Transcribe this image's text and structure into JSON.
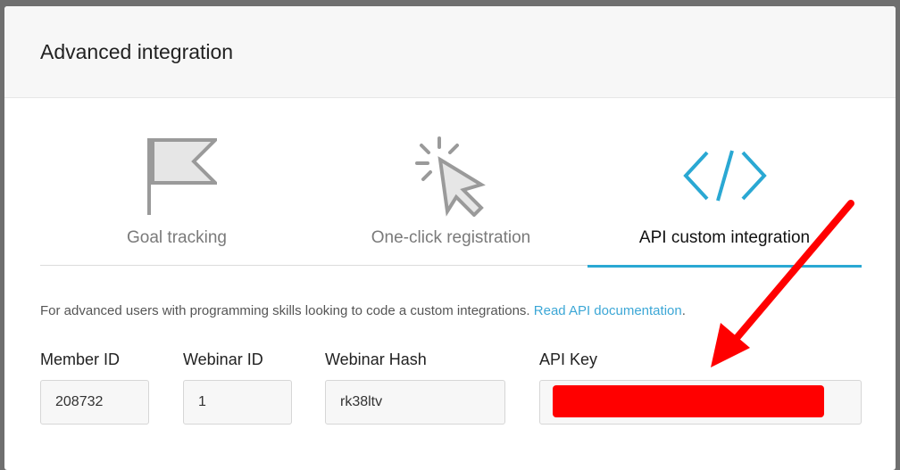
{
  "modal": {
    "title": "Advanced integration"
  },
  "tabs": [
    {
      "label": "Goal tracking",
      "icon": "flag-icon",
      "active": false
    },
    {
      "label": "One-click registration",
      "icon": "cursor-click-icon",
      "active": false
    },
    {
      "label": "API custom integration",
      "icon": "code-icon",
      "active": true
    }
  ],
  "description": {
    "text": "For advanced users with programming skills looking to code a custom integrations. ",
    "link_text": "Read API documentation",
    "suffix": "."
  },
  "fields": {
    "member_id": {
      "label": "Member ID",
      "value": "208732"
    },
    "webinar_id": {
      "label": "Webinar ID",
      "value": "1"
    },
    "webinar_hash": {
      "label": "Webinar Hash",
      "value": "rk38ltv"
    },
    "api_key": {
      "label": "API Key",
      "value": "",
      "redacted": true
    }
  },
  "colors": {
    "accent": "#2aa8d3",
    "link": "#3ca7d6",
    "annotation": "#ff0000"
  }
}
